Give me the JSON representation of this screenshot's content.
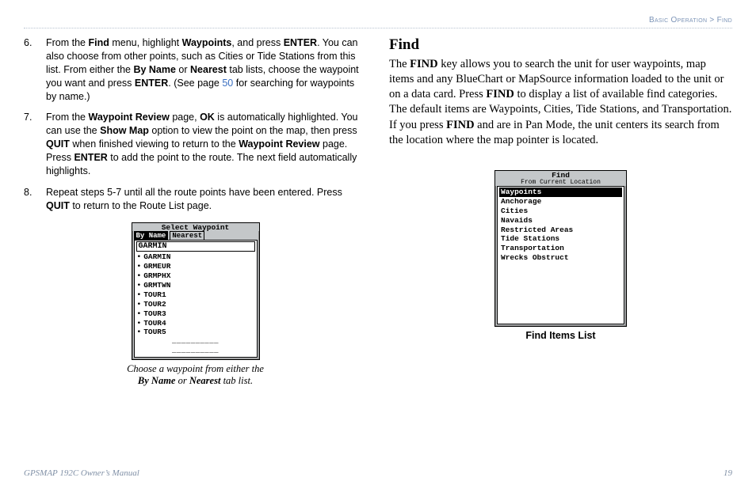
{
  "breadcrumb": {
    "section": "Basic Operation",
    "sep": ">",
    "page": "Find"
  },
  "left": {
    "step6": {
      "t1": "From the ",
      "b1": "Find",
      "t2": " menu, highlight ",
      "b2": "Waypoints",
      "t3": ", and press ",
      "b3": "ENTER",
      "t4": ". You can also choose from other points, such as Cities or Tide Stations from this list. From either the ",
      "b4": "By Name",
      "t5": " or ",
      "b5": "Nearest",
      "t6": " tab lists, choose the waypoint you want and press ",
      "b6": "ENTER",
      "t7": ". (See page ",
      "link": "50",
      "t8": " for searching for waypoints by name.)"
    },
    "step7": {
      "t1": "From the ",
      "b1": "Waypoint Review",
      "t2": " page, ",
      "b2": "OK",
      "t3": " is automatically highlighted. You can use the ",
      "b3": "Show Map",
      "t4": " option to view the point on the map, then press ",
      "b4": "QUIT",
      "t5": " when finished viewing to return to the ",
      "b5": "Waypoint Review",
      "t6": " page. Press ",
      "b6": "ENTER",
      "t7": " to add the point to the route. The next field automatically highlights."
    },
    "step8": {
      "t1": "Repeat steps 5-7 until all the route points have been entered. Press ",
      "b1": "QUIT",
      "t2": " to return to the Route List page."
    },
    "device1": {
      "title": "Select Waypoint",
      "tab_byname": "By Name",
      "tab_nearest": "Nearest",
      "filter": "GARMIN",
      "items": [
        "GARMIN",
        "GRMEUR",
        "GRMPHX",
        "GRMTWN",
        "TOUR1",
        "TOUR2",
        "TOUR3",
        "TOUR4",
        "TOUR5"
      ],
      "dashes1": "__________",
      "dashes2": "__________"
    },
    "caption1": {
      "t1": "Choose a waypoint from either the ",
      "b1": "By Name",
      "t2": " or ",
      "b2": "Nearest",
      "t3": " tab list."
    }
  },
  "right": {
    "heading": "Find",
    "para": {
      "t1": "The ",
      "b1": "FIND",
      "t2": " key allows you to search the unit for user waypoints, map items and any BlueChart or MapSource information loaded to the unit or on a data card. Press ",
      "b2": "FIND",
      "t3": " to display a list of available find categories. The default items are Waypoints, Cities, Tide Stations, and Transportation. If you press ",
      "b3": "FIND",
      "t4": " and are in Pan Mode, the unit centers its search from the location where the map pointer is located."
    },
    "device2": {
      "title": "Find",
      "subtitle": "From Current Location",
      "items": [
        "Waypoints",
        "Anchorage",
        "Cities",
        "Navaids",
        "Restricted Areas",
        "Tide Stations",
        "Transportation",
        "Wrecks Obstruct"
      ],
      "selected_index": 0
    },
    "caption2": "Find Items List"
  },
  "footer": {
    "manual": "GPSMAP 192C Owner’s Manual",
    "pagenum": "19"
  }
}
